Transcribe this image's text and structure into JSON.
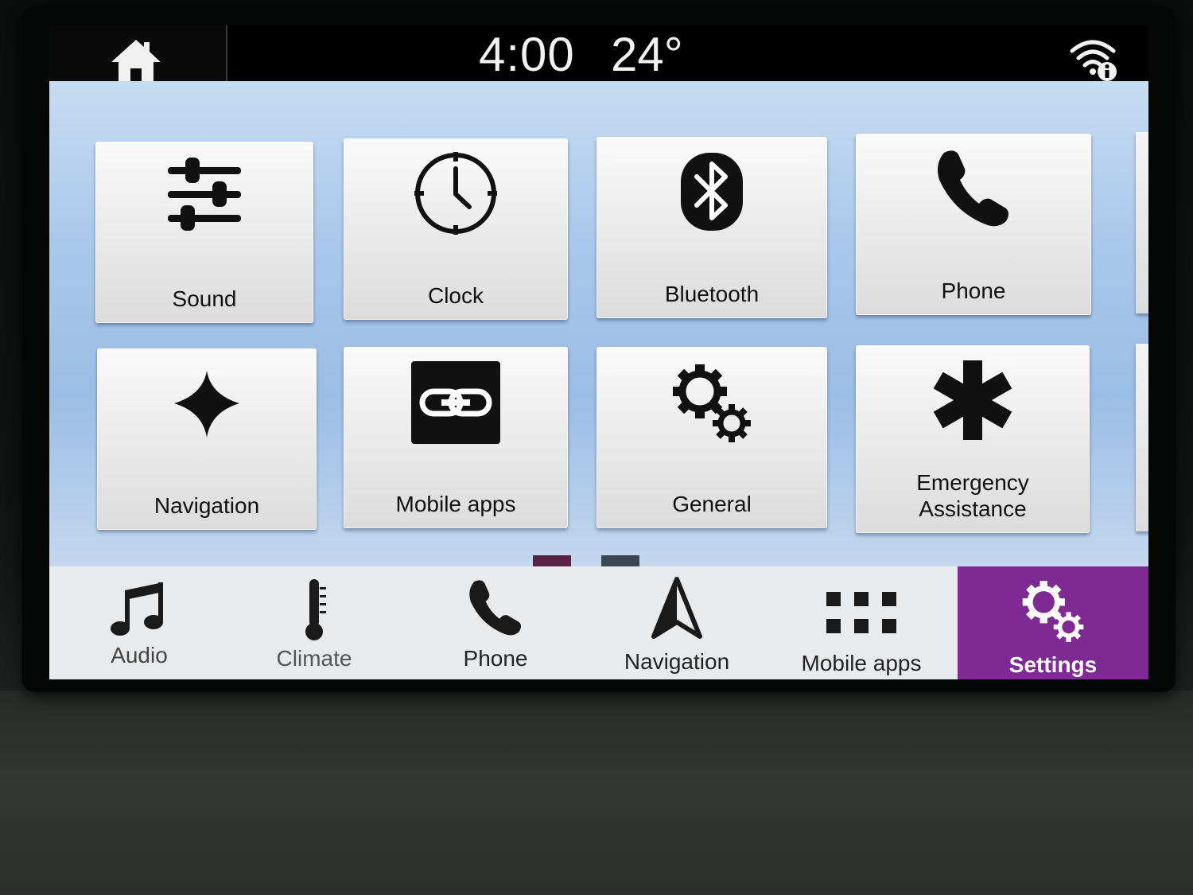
{
  "status_bar": {
    "time": "4:00",
    "temperature": "24°"
  },
  "tiles": [
    {
      "label": "Sound",
      "icon": "sliders-icon"
    },
    {
      "label": "Clock",
      "icon": "clock-icon"
    },
    {
      "label": "Bluetooth",
      "icon": "bluetooth-icon"
    },
    {
      "label": "Phone",
      "icon": "phone-icon"
    },
    {
      "label": "Navigation",
      "icon": "compass-star-icon"
    },
    {
      "label": "Mobile apps",
      "icon": "link-icon"
    },
    {
      "label": "General",
      "icon": "gears-icon"
    },
    {
      "label_line1": "Emergency",
      "label_line2": "Assistance",
      "icon": "asterisk-icon"
    }
  ],
  "pager": {
    "pages": 2,
    "current": 1,
    "active_color": "#5a2145",
    "inactive_color": "#3b4654"
  },
  "nav": [
    {
      "label": "Audio",
      "icon": "music-note-icon"
    },
    {
      "label": "Climate",
      "icon": "thermometer-icon"
    },
    {
      "label": "Phone",
      "icon": "phone-icon"
    },
    {
      "label": "Navigation",
      "icon": "navigation-arrow-icon"
    },
    {
      "label": "Mobile apps",
      "icon": "grid-icon"
    },
    {
      "label": "Settings",
      "icon": "gears-icon",
      "active": true
    }
  ],
  "colors": {
    "accent": "#7e2a93",
    "nav_background": "#e9eaec",
    "tile_background": "#eeeeee"
  }
}
